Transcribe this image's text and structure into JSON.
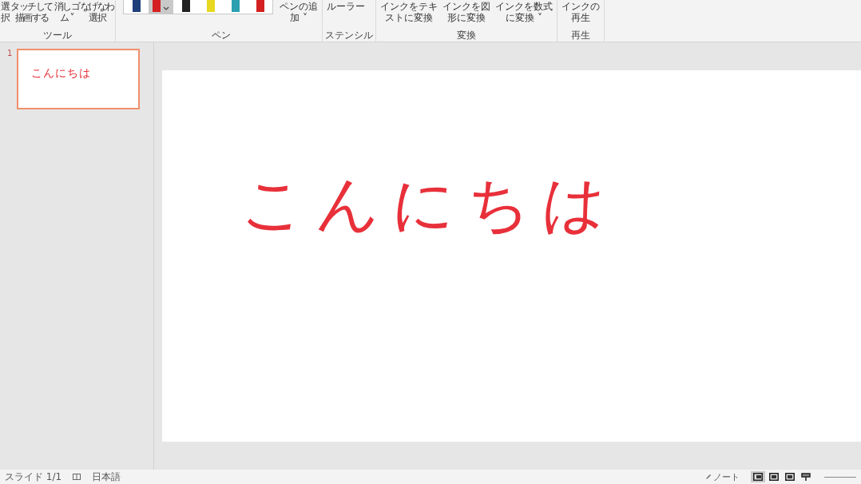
{
  "ribbon": {
    "groups": [
      {
        "label": "ツール",
        "buttons": [
          {
            "lines": [
              "選",
              "択"
            ]
          },
          {
            "lines": [
              "タッチして",
              "描画する"
            ]
          },
          {
            "lines": [
              "消しゴ",
              "ム ˅"
            ]
          },
          {
            "lines": [
              "なげなわ",
              "選択"
            ]
          }
        ]
      },
      {
        "label": "ペン",
        "pens": [
          {
            "color": "#1f3f7a",
            "selected": false
          },
          {
            "color": "#d42020",
            "selected": true
          },
          {
            "color": "#222222",
            "selected": false
          },
          {
            "color": "#e8d820",
            "selected": false
          },
          {
            "color": "#2aa0b0",
            "selected": false
          },
          {
            "color": "#d42020",
            "selected": false
          }
        ],
        "buttons": [
          {
            "lines": [
              "ペンの追",
              "加 ˅"
            ]
          }
        ]
      },
      {
        "label": "ステンシル",
        "buttons": [
          {
            "lines": [
              "ルーラー"
            ]
          }
        ]
      },
      {
        "label": "変換",
        "buttons": [
          {
            "lines": [
              "インクをテキ",
              "ストに変換"
            ]
          },
          {
            "lines": [
              "インクを図",
              "形に変換"
            ]
          },
          {
            "lines": [
              "インクを数式",
              "に変換 ˅"
            ]
          }
        ]
      },
      {
        "label": "再生",
        "buttons": [
          {
            "lines": [
              "インクの",
              "再生"
            ]
          }
        ]
      }
    ]
  },
  "slides": [
    {
      "number": "1",
      "selected": true,
      "ink_text": "こんにちは"
    }
  ],
  "slide": {
    "ink_text": "こんにちは",
    "color": "#e8303a"
  },
  "status_bar": {
    "slide_counter": "スライド 1/1",
    "language": "日本語",
    "notes": "ノート",
    "views": [
      {
        "selected": true
      },
      {
        "selected": false
      },
      {
        "selected": false
      },
      {
        "selected": false
      }
    ]
  }
}
